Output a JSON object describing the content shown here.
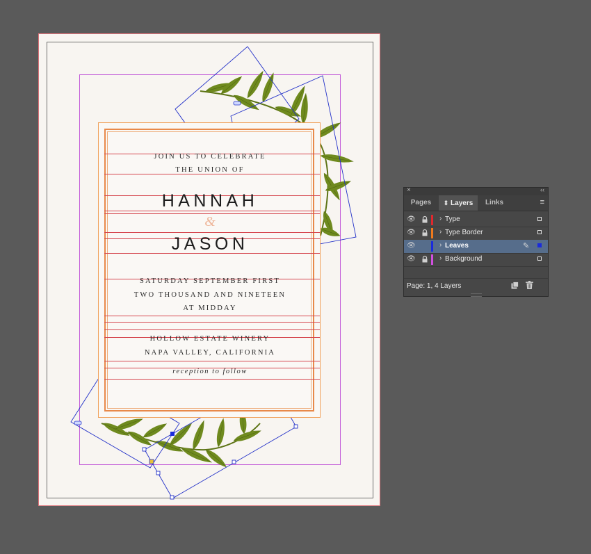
{
  "invitation": {
    "join_line": "JOIN US TO CELEBRATE",
    "union_line": "THE UNION OF",
    "name_one": "HANNAH",
    "ampersand": "&",
    "name_two": "JASON",
    "date_line_1": "SATURDAY SEPTEMBER FIRST",
    "date_line_2": "TWO THOUSAND AND NINETEEN",
    "time_line": "AT MIDDAY",
    "separator": "·",
    "venue_line_1": "HOLLOW ESTATE WINERY",
    "venue_line_2": "NAPA VALLEY, CALIFORNIA",
    "reception_line": "reception to follow"
  },
  "panel": {
    "close_glyph": "×",
    "collapse_glyph": "‹‹",
    "tabs": [
      {
        "label": "Pages",
        "active": false
      },
      {
        "label": "Layers",
        "active": true
      },
      {
        "label": "Links",
        "active": false
      }
    ],
    "layers_tab_icon": "⇕",
    "menu_glyph": "≡",
    "layers": [
      {
        "name": "Type",
        "color": "#e0282e",
        "locked": true,
        "selected": false
      },
      {
        "name": "Type Border",
        "color": "#f07a1d",
        "locked": true,
        "selected": false
      },
      {
        "name": "Leaves",
        "color": "#1a2bdc",
        "locked": false,
        "selected": true
      },
      {
        "name": "Background",
        "color": "#d14fe0",
        "locked": true,
        "selected": false
      }
    ],
    "eye_glyph": "👁",
    "chevron_glyph": "›",
    "pen_glyph": "✎",
    "footer_status": "Page: 1, 4 Layers"
  },
  "colors": {
    "pasteboard": "#5a5a5a",
    "leaf_green": "#6f8a1e",
    "selection_blue": "#1a2bdc",
    "type_guide_red": "#d5464e",
    "background_frame_magenta": "#c25ad8",
    "card_border_orange": "#e8894a"
  }
}
